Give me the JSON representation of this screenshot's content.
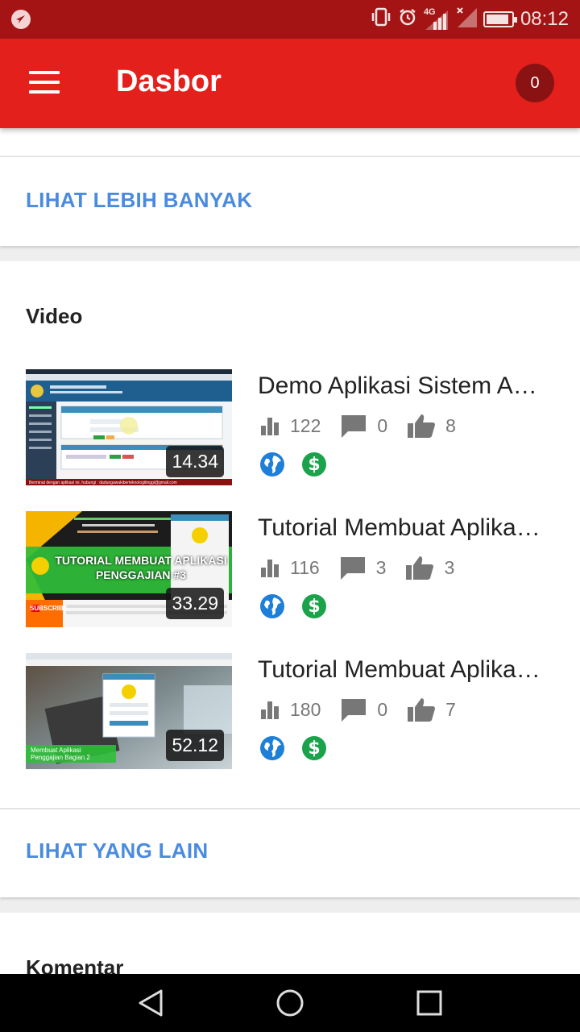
{
  "status_bar": {
    "network": "4G",
    "time": "08:12",
    "battery_level": 0.9
  },
  "app_bar": {
    "title": "Dasbor",
    "notification_count": "0"
  },
  "top_card": {
    "more_label": "LIHAT LEBIH BANYAK"
  },
  "video_section": {
    "title": "Video",
    "items": [
      {
        "title": "Demo Aplikasi Sistem A…",
        "duration": "14.34",
        "views": "122",
        "comments": "0",
        "likes": "8",
        "thumb_caption": "Berminat dengan aplikasi ini, hubungi : dadungawukiberteknologitinggi@gmail.com"
      },
      {
        "title": "Tutorial Membuat Aplika…",
        "duration": "33.29",
        "views": "116",
        "comments": "3",
        "likes": "3",
        "thumb_heading": "TUTORIAL MEMBUAT APLIKASI PENGGAJIAN #3",
        "thumb_subscribe": "SUBSCRIBE"
      },
      {
        "title": "Tutorial Membuat Aplika…",
        "duration": "52.12",
        "views": "180",
        "comments": "0",
        "likes": "7",
        "thumb_caption": "Membuat Aplikasi Penggajian Bagian 2"
      }
    ],
    "other_label": "LIHAT YANG LAIN"
  },
  "comment_section": {
    "title": "Komentar"
  },
  "colors": {
    "status_bar": "#a51414",
    "app_bar": "#e3201b",
    "badge": "#8a1212",
    "link": "#4a8be0",
    "globe": "#1e7fd8",
    "money": "#1aa34a"
  },
  "icons": {
    "menu": "hamburger-icon",
    "views": "bar-chart-icon",
    "comments": "comment-icon",
    "likes": "thumbs-up-icon",
    "public": "globe-icon",
    "monetized": "dollar-icon",
    "nav_back": "triangle-back-icon",
    "nav_home": "circle-home-icon",
    "nav_recent": "square-recent-icon"
  }
}
